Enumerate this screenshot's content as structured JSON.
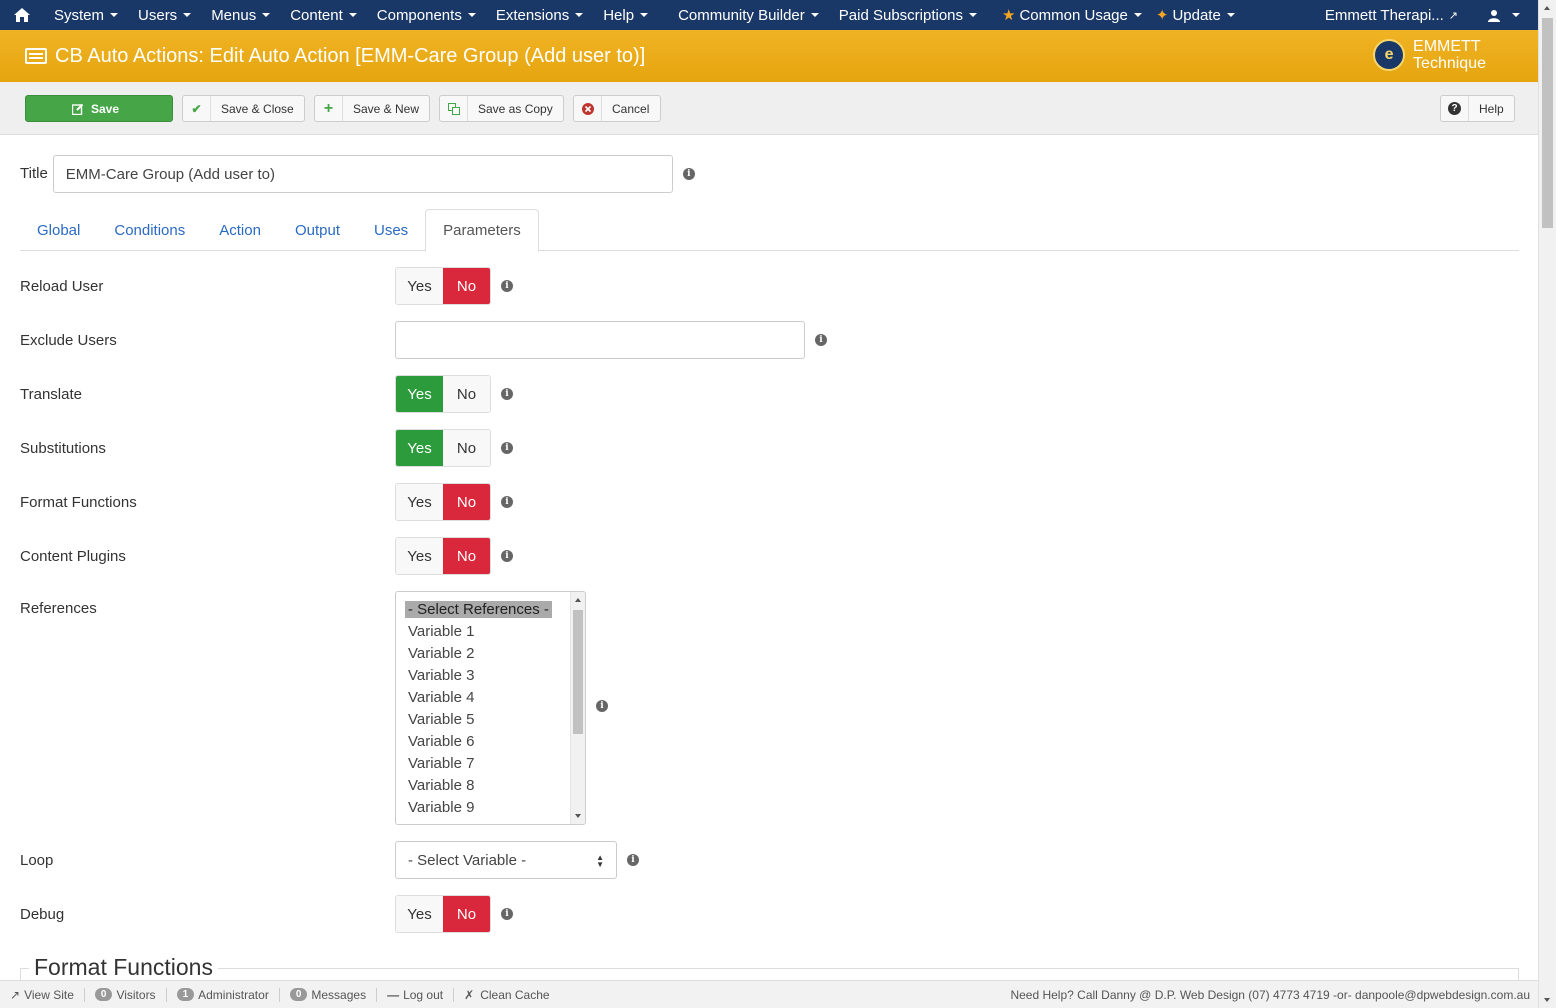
{
  "navbar": {
    "home_icon": "home-icon",
    "items": [
      "System",
      "Users",
      "Menus",
      "Content",
      "Components",
      "Extensions",
      "Help",
      "Community Builder",
      "Paid Subscriptions"
    ],
    "common_usage": "Common Usage",
    "update": "Update",
    "site_name": "Emmett Therapi...",
    "user_icon": "user-icon"
  },
  "header": {
    "title": "CB Auto Actions: Edit Auto Action [EMM-Care Group (Add user to)]",
    "logo_line1": "EMMETT",
    "logo_line2": "Technique"
  },
  "toolbar": {
    "save": "Save",
    "save_close": "Save & Close",
    "save_new": "Save & New",
    "save_copy": "Save as Copy",
    "cancel": "Cancel",
    "help": "Help"
  },
  "form": {
    "title_label": "Title",
    "title_value": "EMM-Care Group (Add user to)",
    "tabs": [
      "Global",
      "Conditions",
      "Action",
      "Output",
      "Uses",
      "Parameters"
    ],
    "active_tab": "Parameters",
    "yes": "Yes",
    "no": "No",
    "reload_user": "Reload User",
    "exclude_users": "Exclude Users",
    "exclude_users_value": "",
    "translate": "Translate",
    "substitutions": "Substitutions",
    "format_functions": "Format Functions",
    "content_plugins": "Content Plugins",
    "references": "References",
    "references_options": [
      "- Select References -",
      "Variable 1",
      "Variable 2",
      "Variable 3",
      "Variable 4",
      "Variable 5",
      "Variable 6",
      "Variable 7",
      "Variable 8",
      "Variable 9"
    ],
    "loop": "Loop",
    "loop_value": "- Select Variable -",
    "debug": "Debug",
    "section_title": "Format Functions"
  },
  "status": {
    "view_site": "View Site",
    "visitors_count": "0",
    "visitors": "Visitors",
    "admin_count": "1",
    "administrator": "Administrator",
    "messages_count": "0",
    "messages": "Messages",
    "log_out": "Log out",
    "clean_cache": "Clean Cache",
    "help_text": "Need Help? Call Danny @ D.P. Web Design (07) 4773 4719 -or- danpoole@dpwebdesign.com.au"
  },
  "colors": {
    "navbar": "#1a3867",
    "header": "#e8a912",
    "save": "#46a546",
    "yes_on": "#2b9b3b",
    "no_on": "#d9283b"
  }
}
